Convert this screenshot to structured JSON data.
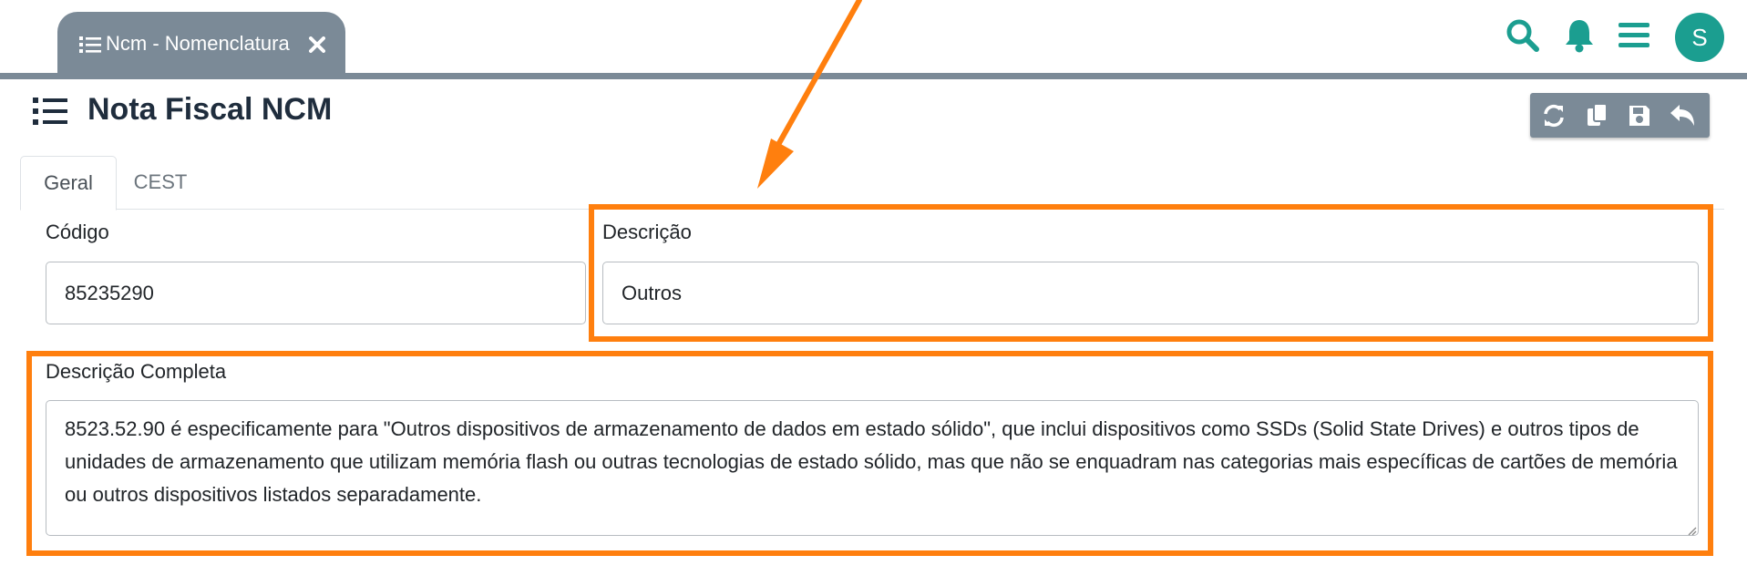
{
  "window": {
    "tab_label": "Ncm - Nomenclatura",
    "user_initial": "S"
  },
  "header_icons": [
    "search-icon",
    "bell-icon",
    "hamburger-menu-icon"
  ],
  "page": {
    "title": "Nota Fiscal NCM"
  },
  "toolbar": {
    "buttons": [
      "refresh-icon",
      "copy-icon",
      "save-icon",
      "undo-icon"
    ]
  },
  "tabs": [
    {
      "label": "Geral",
      "active": true
    },
    {
      "label": "CEST",
      "active": false
    }
  ],
  "form": {
    "codigo": {
      "label": "Código",
      "value": "85235290"
    },
    "descricao": {
      "label": "Descrição",
      "value": "Outros"
    },
    "descricao_completa": {
      "label": "Descrição Completa",
      "value": "8523.52.90 é especificamente para \"Outros dispositivos de armazenamento de dados em estado sólido\", que inclui dispositivos como SSDs (Solid State Drives) e outros tipos de unidades de armazenamento que utilizam memória flash ou outras tecnologias de estado sólido, mas que não se enquadram nas categorias mais específicas de cartões de memória ou outros dispositivos listados separadamente."
    }
  },
  "colors": {
    "teal_accent": "#1b9e90",
    "tab_gray": "#7b8a97",
    "highlight_orange": "#ff7f0e"
  }
}
